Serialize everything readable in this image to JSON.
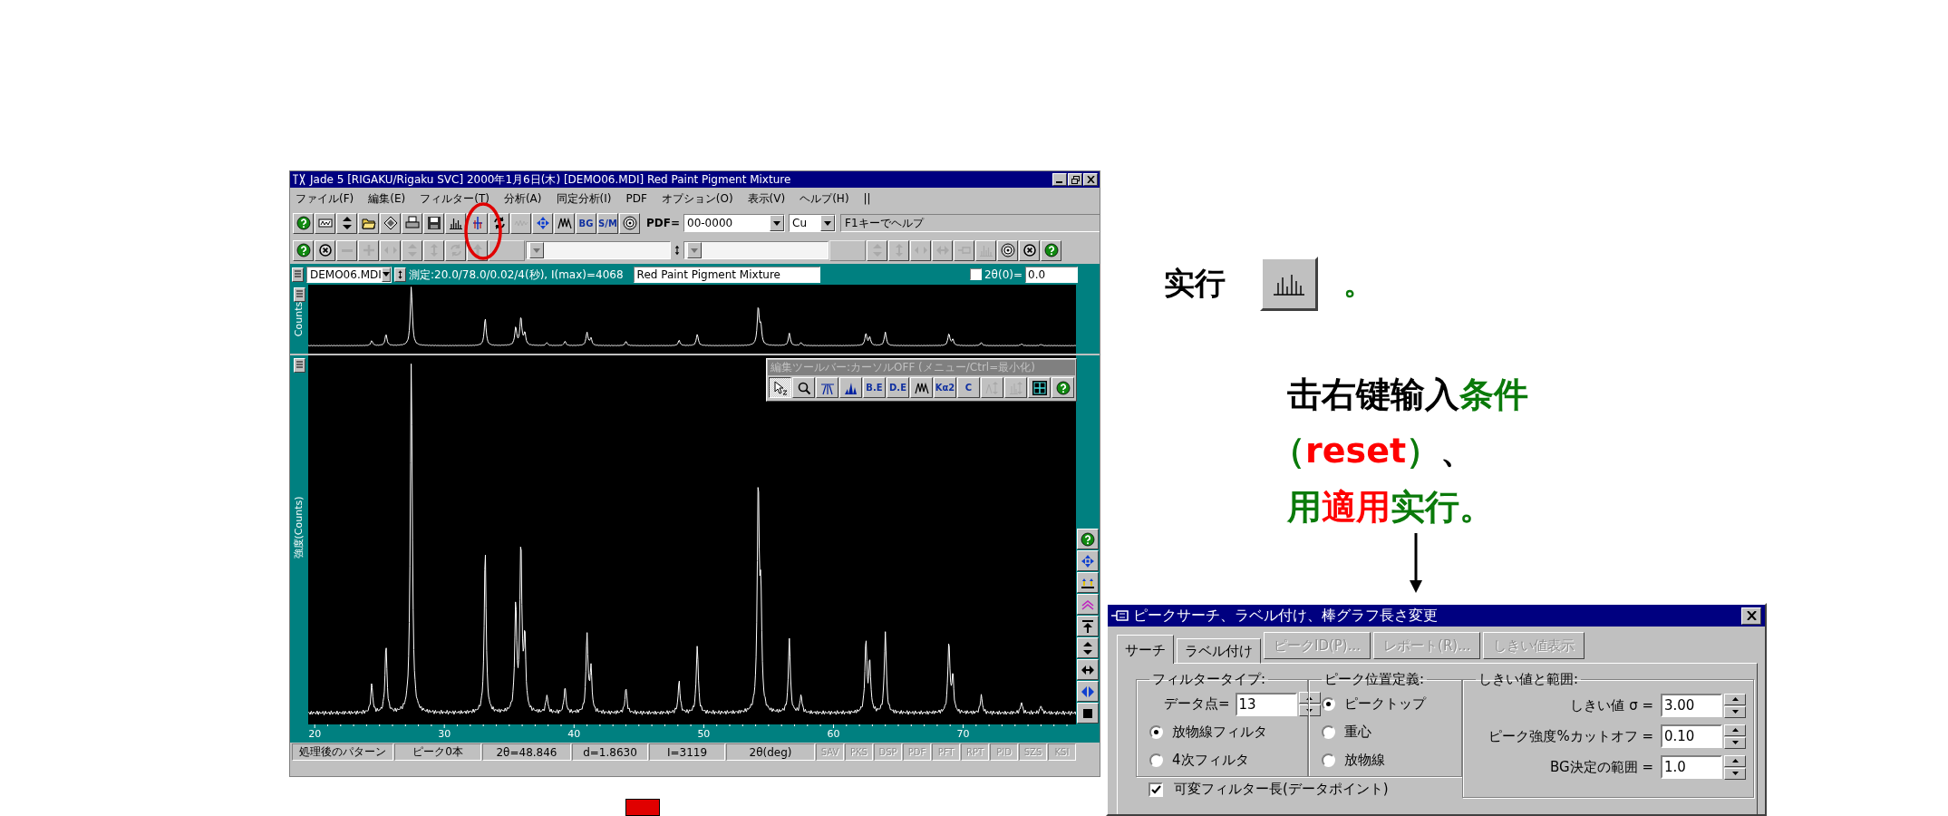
{
  "main_window": {
    "title": "Jade 5 [RIGAKU/Rigaku SVC] 2000年1月6日(木) [DEMO06.MDI] Red Paint Pigment Mixture",
    "menu": [
      "ファイル(F)",
      "編集(E)",
      "フィルター(T)",
      "分析(A)",
      "同定分析(I)",
      "PDF",
      "オプション(O)",
      "表示(V)",
      "ヘルプ(H)",
      "||"
    ],
    "toolbar_1": {
      "items": [
        {
          "kind": "help",
          "disabled": false
        },
        {
          "kind": "key",
          "disabled": false
        },
        {
          "kind": "ud",
          "disabled": false
        },
        {
          "kind": "folder",
          "disabled": false
        },
        {
          "kind": "diamond",
          "disabled": false
        },
        {
          "kind": "printer",
          "disabled": false
        },
        {
          "kind": "disk",
          "disabled": false
        },
        {
          "kind": "bars",
          "disabled": false
        },
        {
          "kind": "marker",
          "disabled": false
        },
        {
          "kind": "rotate",
          "disabled": false
        },
        {
          "kind": "noise",
          "disabled": true
        },
        {
          "kind": "four",
          "disabled": false
        },
        {
          "kind": "peaks",
          "disabled": false
        },
        {
          "kind": "text",
          "label": "BG",
          "disabled": false
        },
        {
          "kind": "text",
          "label": "S/M",
          "disabled": false
        },
        {
          "kind": "disc",
          "disabled": false
        }
      ],
      "pdf_label": "PDF=",
      "pdf_combo": "00-0000",
      "target_combo": "Cu",
      "hint": "F1キーでヘルプ"
    },
    "toolbar_2": {
      "items": [
        {
          "kind": "help",
          "disabled": false
        },
        {
          "kind": "cross",
          "disabled": false
        },
        {
          "kind": "minus",
          "disabled": true
        },
        {
          "kind": "plus",
          "disabled": true
        },
        {
          "kind": "lr",
          "disabled": true
        },
        {
          "kind": "ud",
          "disabled": true
        },
        {
          "kind": "ud2",
          "disabled": true
        },
        {
          "kind": "rotate",
          "disabled": true
        },
        {
          "kind": "up",
          "disabled": true
        },
        {
          "kind": "blank",
          "disabled": true
        },
        {
          "kind": "combo",
          "disabled": true
        },
        {
          "kind": "updown",
          "disabled": false
        },
        {
          "kind": "combo",
          "disabled": true
        },
        {
          "kind": "blank",
          "disabled": true
        },
        {
          "kind": "ud",
          "disabled": true
        },
        {
          "kind": "ud2",
          "disabled": true
        },
        {
          "kind": "lr",
          "disabled": true
        },
        {
          "kind": "lr2",
          "disabled": true
        },
        {
          "kind": "pin",
          "disabled": true
        },
        {
          "kind": "bars",
          "disabled": true
        },
        {
          "kind": "disc",
          "disabled": false
        },
        {
          "kind": "cross",
          "disabled": false
        },
        {
          "kind": "help",
          "disabled": false
        }
      ]
    },
    "info_bar": {
      "file_combo": "DEMO06.MDI",
      "measurement": "測定:20.0/78.0/0.02/4(秒), I(max)=4068",
      "sample_name": "Red Paint Pigment Mixture",
      "offset_checked": false,
      "offset_label": "2θ(0)=",
      "offset_value": "0.0"
    },
    "overview": {
      "ylabel": "Counts"
    },
    "plot": {
      "ylabel": "強度(Counts)",
      "x_tick_labels": [
        "20",
        "30",
        "40",
        "50",
        "60",
        "70"
      ]
    },
    "edit_toolbar": {
      "title": "編集ツールバー:カーソルOFF (メニュー/Ctrl=最小化)",
      "items": [
        {
          "kind": "cursor",
          "selected": true,
          "disabled": false
        },
        {
          "kind": "magnifier",
          "selected": false,
          "disabled": false
        },
        {
          "kind": "peakline",
          "selected": false,
          "disabled": false
        },
        {
          "kind": "peakfill",
          "selected": false,
          "disabled": false
        },
        {
          "kind": "text",
          "label": "B.E",
          "selected": false,
          "disabled": false
        },
        {
          "kind": "text",
          "label": "D.E",
          "selected": false,
          "disabled": false
        },
        {
          "kind": "peaks",
          "selected": false,
          "disabled": false
        },
        {
          "kind": "text",
          "label": "Kα2",
          "selected": false,
          "disabled": false
        },
        {
          "kind": "text",
          "label": "C",
          "selected": false,
          "disabled": false
        },
        {
          "kind": "peakarrows",
          "selected": false,
          "disabled": true
        },
        {
          "kind": "bararrows",
          "selected": false,
          "disabled": true
        },
        {
          "kind": "grid",
          "selected": false,
          "disabled": false
        },
        {
          "kind": "help",
          "selected": false,
          "disabled": false
        }
      ]
    },
    "side_tools": [
      {
        "kind": "help"
      },
      {
        "kind": "four"
      },
      {
        "kind": "dual"
      },
      {
        "kind": "chevrons"
      },
      {
        "kind": "top"
      },
      {
        "kind": "ud"
      },
      {
        "kind": "lr2"
      },
      {
        "kind": "lrblue"
      },
      {
        "kind": "square"
      }
    ],
    "status_bar": {
      "fields": [
        "処理後のパターン",
        "ピーク0本",
        "2θ=48.846",
        "d=1.8630",
        "I=3119",
        "2θ(deg)"
      ],
      "flags": [
        {
          "label": "SAV",
          "disabled": true
        },
        {
          "label": "PKS",
          "disabled": true
        },
        {
          "label": "DSP",
          "disabled": true
        },
        {
          "label": "PDF",
          "disabled": true
        },
        {
          "label": "PFT",
          "disabled": true
        },
        {
          "label": "RPT",
          "disabled": true
        },
        {
          "label": "PID",
          "disabled": true
        },
        {
          "label": "SZS",
          "disabled": true
        },
        {
          "label": "KSI",
          "disabled": true
        }
      ]
    }
  },
  "notes": {
    "run_line": [
      {
        "kind": "text",
        "text": "实行",
        "color": "#000000"
      },
      {
        "kind": "button"
      },
      {
        "kind": "text",
        "text": "。",
        "color": "#0a7a0a"
      }
    ],
    "instruction_lines": [
      [
        {
          "text": "击右键输入",
          "color": "#000000"
        },
        {
          "text": "条件",
          "color": "#0a7a0a"
        }
      ],
      [
        {
          "text": "（",
          "color": "#0a7a0a"
        },
        {
          "text": "reset",
          "color": "#ff0000"
        },
        {
          "text": "）",
          "color": "#0a7a0a"
        },
        {
          "text": "、",
          "color": "#000000"
        }
      ],
      [
        {
          "text": "用",
          "color": "#0a7a0a"
        },
        {
          "text": "適用",
          "color": "#ff0000"
        },
        {
          "text": "实行。",
          "color": "#0a7a0a"
        }
      ]
    ]
  },
  "dialog": {
    "title": "ピークサーチ、ラベル付け、棒グラフ長さ変更",
    "tabs": [
      {
        "label": "サーチ",
        "selected": true
      },
      {
        "label": "ラベル付け",
        "selected": false
      }
    ],
    "buttons": [
      {
        "label": "ピークID(P)...",
        "disabled": true
      },
      {
        "label": "レポート(R)...",
        "disabled": true
      },
      {
        "label": "しきい値表示",
        "disabled": true
      }
    ],
    "filter_group": {
      "title": "フィルタータイプ:",
      "points_label": "データ点=",
      "points_value": "13",
      "options": [
        {
          "label": "放物線フィルタ",
          "selected": true
        },
        {
          "label": "4次フィルタ",
          "selected": false
        }
      ]
    },
    "position_group": {
      "title": "ピーク位置定義:",
      "options": [
        {
          "label": "ピークトップ",
          "selected": true
        },
        {
          "label": "重心",
          "selected": false
        },
        {
          "label": "放物線",
          "selected": false
        }
      ]
    },
    "threshold_group": {
      "title": "しきい値と範囲:",
      "fields": [
        {
          "label": "しきい値 σ =",
          "value": "3.00"
        },
        {
          "label": "ピーク強度%カットオフ =",
          "value": "0.10"
        },
        {
          "label": "BG決定の範囲 =",
          "value": "1.0"
        }
      ]
    },
    "variable_filter": {
      "label": "可変フィルター長(データポイント)",
      "checked": true
    }
  }
}
